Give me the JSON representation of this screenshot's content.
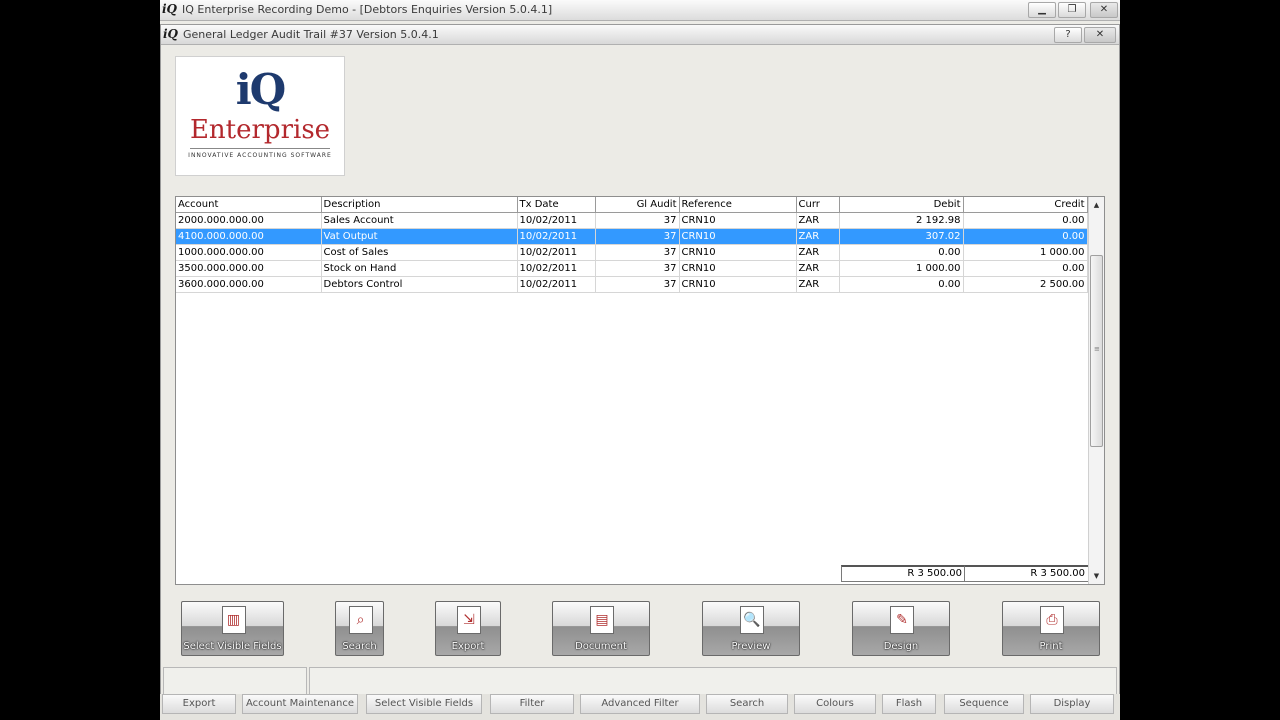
{
  "outer_window": {
    "icon": "iQ",
    "title": "IQ Enterprise Recording Demo - [Debtors Enquiries Version 5.0.4.1]",
    "controls": [
      "▁",
      "❐",
      "✕"
    ]
  },
  "inner_window": {
    "icon": "iQ",
    "title": "General Ledger Audit Trail #37 Version 5.0.4.1",
    "controls": [
      "?",
      "✕"
    ]
  },
  "logo": {
    "iq": "iQ",
    "name": "Enterprise",
    "tagline": "INNOVATIVE ACCOUNTING SOFTWARE"
  },
  "table": {
    "columns": [
      "Account",
      "Description",
      "Tx Date",
      "Gl Audit",
      "Reference",
      "Curr",
      "Debit",
      "Credit"
    ],
    "rows": [
      [
        "2000.000.000.00",
        "Sales Account",
        "10/02/2011",
        "37",
        "CRN10",
        "ZAR",
        "2 192.98",
        "0.00"
      ],
      [
        "4100.000.000.00",
        "Vat Output",
        "10/02/2011",
        "37",
        "CRN10",
        "ZAR",
        "307.02",
        "0.00"
      ],
      [
        "1000.000.000.00",
        "Cost of Sales",
        "10/02/2011",
        "37",
        "CRN10",
        "ZAR",
        "0.00",
        "1 000.00"
      ],
      [
        "3500.000.000.00",
        "Stock on Hand",
        "10/02/2011",
        "37",
        "CRN10",
        "ZAR",
        "1 000.00",
        "0.00"
      ],
      [
        "3600.000.000.00",
        "Debtors Control",
        "10/02/2011",
        "37",
        "CRN10",
        "ZAR",
        "0.00",
        "2 500.00"
      ]
    ],
    "selected_row": 1,
    "totals": {
      "debit": "R 3 500.00",
      "credit": "R 3 500.00"
    }
  },
  "toolbar": {
    "buttons": [
      {
        "label": "Select Visible Fields",
        "icon": "columns-icon",
        "glyph": "▥"
      },
      {
        "label": "Search",
        "icon": "search-icon",
        "glyph": "⌕"
      },
      {
        "label": "Export",
        "icon": "export-icon",
        "glyph": "⇲"
      },
      {
        "label": "Document",
        "icon": "document-icon",
        "glyph": "▤"
      },
      {
        "label": "Preview",
        "icon": "preview-icon",
        "glyph": "🔍"
      },
      {
        "label": "Design",
        "icon": "design-icon",
        "glyph": "✎"
      },
      {
        "label": "Print",
        "icon": "printer-icon",
        "glyph": "⎙"
      }
    ]
  },
  "function_keys": [
    "Export",
    "Account Maintenance",
    "Select Visible Fields",
    "Filter",
    "Advanced Filter",
    "Search",
    "Colours",
    "Flash",
    "Sequence",
    "Display"
  ]
}
